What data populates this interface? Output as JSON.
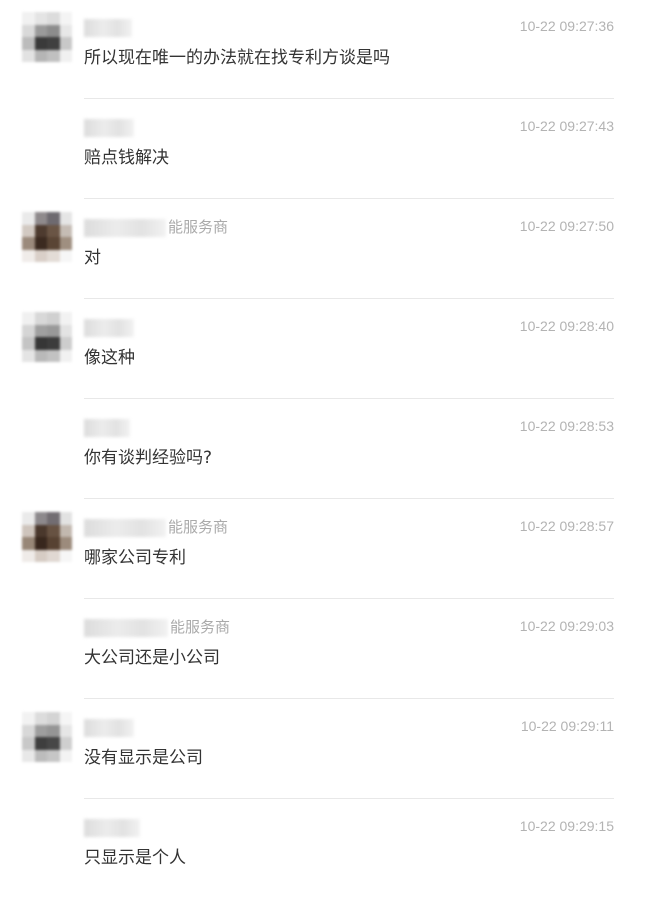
{
  "messages": [
    {
      "name_visible": "",
      "time": "10-22 09:27:36",
      "text": "所以现在唯一的办法就在找专利方谈是吗",
      "avatar": "dark"
    },
    {
      "name_visible": "",
      "time": "10-22 09:27:43",
      "text": "赔点钱解决",
      "avatar": "none"
    },
    {
      "name_visible": "能服务商",
      "time": "10-22 09:27:50",
      "text": "对",
      "avatar": "brown"
    },
    {
      "name_visible": "",
      "time": "10-22 09:28:40",
      "text": "像这种",
      "avatar": "dark"
    },
    {
      "name_visible": "",
      "time": "10-22 09:28:53",
      "text": "你有谈判经验吗?",
      "avatar": "none"
    },
    {
      "name_visible": "能服务商",
      "time": "10-22 09:28:57",
      "text": "哪家公司专利",
      "avatar": "brown"
    },
    {
      "name_visible": "能服务商",
      "time": "10-22 09:29:03",
      "text": "大公司还是小公司",
      "avatar": "none"
    },
    {
      "name_visible": "",
      "time": "10-22 09:29:11",
      "text": "没有显示是公司",
      "avatar": "dark"
    },
    {
      "name_visible": "",
      "time": "10-22 09:29:15",
      "text": "只显示是个人",
      "avatar": "none"
    }
  ]
}
